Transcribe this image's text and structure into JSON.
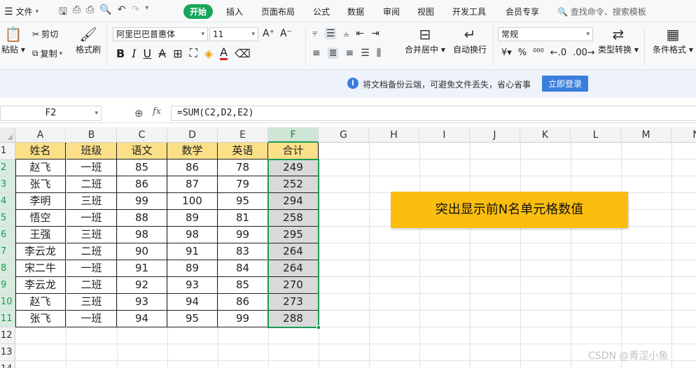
{
  "menu": {
    "file_label": "文件",
    "tabs": [
      "开始",
      "插入",
      "页面布局",
      "公式",
      "数据",
      "审阅",
      "视图",
      "开发工具",
      "会员专享"
    ],
    "active_tab": "开始",
    "search_placeholder": "查找命令、搜索模板"
  },
  "ribbon": {
    "paste": "粘贴",
    "cut": "剪切",
    "copy": "复制",
    "format_painter": "格式刷",
    "font_name": "阿里巴巴普惠体",
    "font_size": "11",
    "merge_center": "合并居中",
    "wrap_text": "自动换行",
    "number_format": "常规",
    "type_convert": "类型转换",
    "conditional_format": "条件格式"
  },
  "banner": {
    "message": "将文档备份云端，可避免文件丢失，省心省事",
    "login_button": "立即登录"
  },
  "formula_bar": {
    "name_box": "F2",
    "fx_label": "fx",
    "formula": "=SUM(C2,D2,E2)"
  },
  "sheet": {
    "columns": [
      "A",
      "B",
      "C",
      "D",
      "E",
      "F",
      "G",
      "H",
      "I",
      "J",
      "K",
      "L",
      "M",
      "N"
    ],
    "rows": [
      "1",
      "2",
      "3",
      "4",
      "5",
      "6",
      "7",
      "8",
      "9",
      "10",
      "11",
      "12",
      "13",
      "14"
    ],
    "selected_column": "F",
    "header": [
      "姓名",
      "班级",
      "语文",
      "数学",
      "英语",
      "合计"
    ],
    "data": [
      [
        "赵飞",
        "一班",
        "85",
        "86",
        "78",
        "249"
      ],
      [
        "张飞",
        "二班",
        "86",
        "87",
        "79",
        "252"
      ],
      [
        "李明",
        "三班",
        "99",
        "100",
        "95",
        "294"
      ],
      [
        "悟空",
        "一班",
        "88",
        "89",
        "81",
        "258"
      ],
      [
        "王强",
        "三班",
        "98",
        "98",
        "99",
        "295"
      ],
      [
        "李云龙",
        "二班",
        "90",
        "91",
        "83",
        "264"
      ],
      [
        "宋二牛",
        "一班",
        "91",
        "89",
        "84",
        "264"
      ],
      [
        "李云龙",
        "二班",
        "92",
        "93",
        "85",
        "270"
      ],
      [
        "赵飞",
        "三班",
        "93",
        "94",
        "86",
        "273"
      ],
      [
        "张飞",
        "一班",
        "94",
        "95",
        "99",
        "288"
      ]
    ]
  },
  "callout": "突出显示前N名单元格数值",
  "watermark": "CSDN @青涩小鱼",
  "colors": {
    "accent_green": "#1d9a55",
    "header_fill": "#fbe088",
    "total_fill": "#d9d9d9",
    "callout_fill": "#fbbd0e",
    "login_blue": "#3b7ddd"
  }
}
